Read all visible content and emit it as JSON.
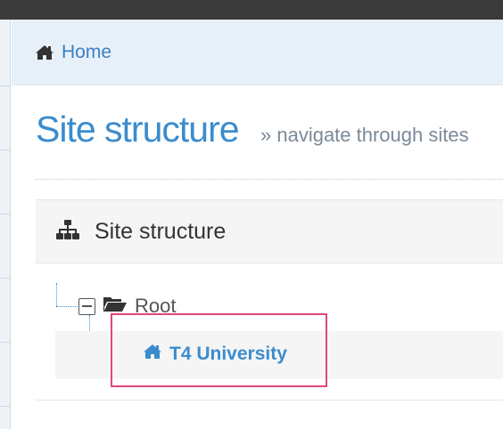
{
  "breadcrumb": {
    "home_label": "Home",
    "home_icon": "home-icon"
  },
  "page": {
    "title": "Site structure",
    "subtitle": "» navigate through sites"
  },
  "panel": {
    "title": "Site structure",
    "icon": "sitemap-icon"
  },
  "tree": {
    "root": {
      "label": "Root",
      "icon": "folder-open-icon",
      "toggle": "collapse-icon",
      "expanded": true
    },
    "children": [
      {
        "label": "T4 University",
        "icon": "home-icon",
        "highlighted": true
      }
    ]
  },
  "colors": {
    "topbar": "#3a3a3a",
    "breadcrumb_bg": "#e7f0f8",
    "link": "#3b7fc4",
    "title": "#3b8ccd",
    "highlight": "#e0467c"
  }
}
